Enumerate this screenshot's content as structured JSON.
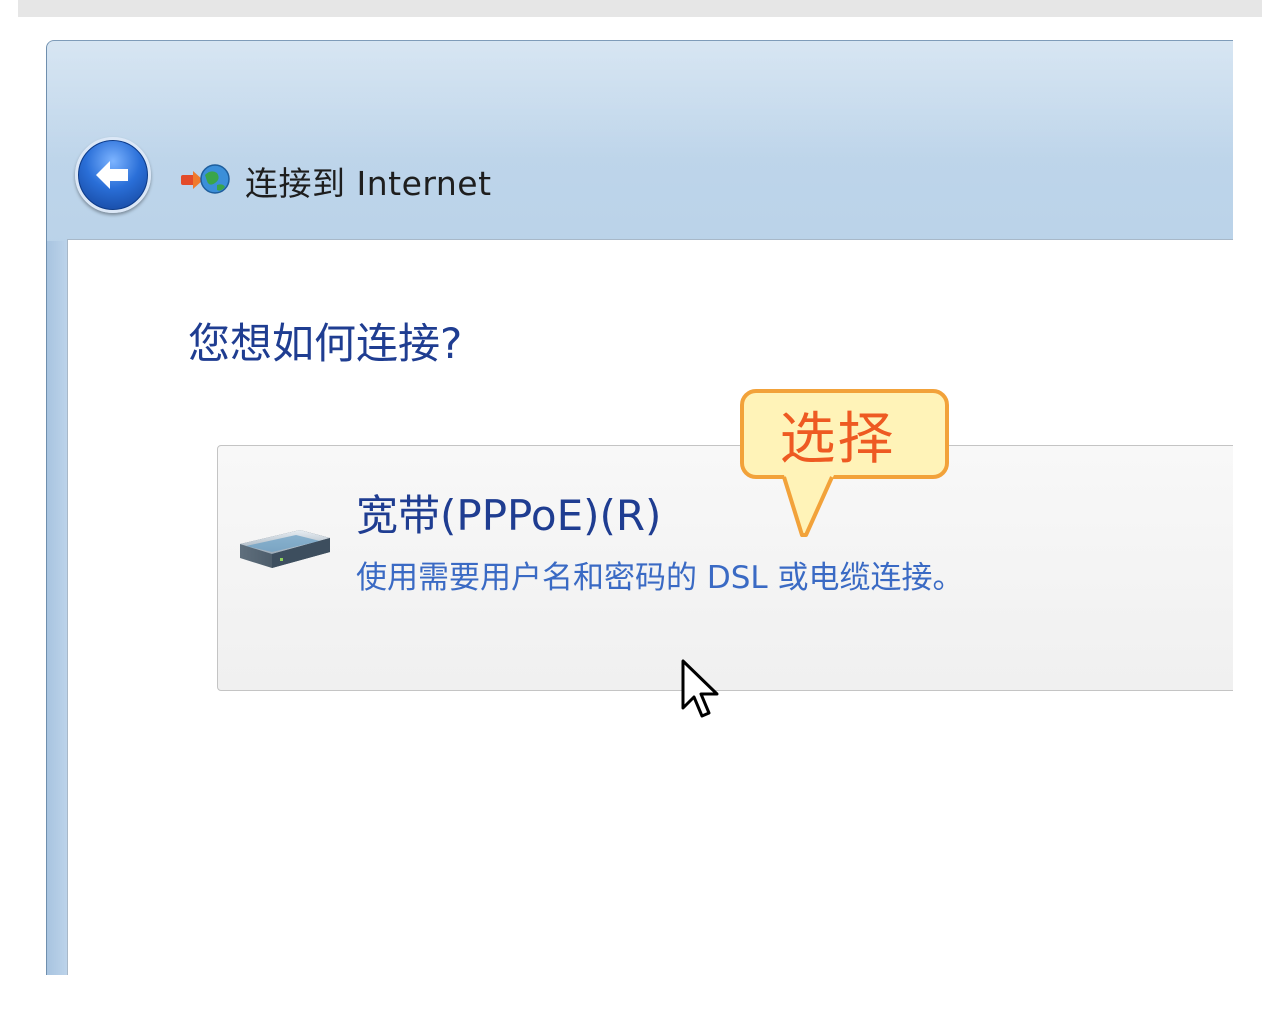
{
  "window": {
    "title": "连接到 Internet",
    "back_button_icon": "back-arrow-icon",
    "title_icon": "network-connection-icon"
  },
  "main": {
    "question": "您想如何连接?",
    "options": [
      {
        "title": "宽带(PPPoE)(R)",
        "description": "使用需要用户名和密码的 DSL 或电缆连接。",
        "icon": "broadband-modem-icon"
      }
    ]
  },
  "annotation": {
    "callout_text": "选择",
    "border_color": "#f2a23a",
    "fill_color": "#fff3b8",
    "text_color": "#ee5a22"
  },
  "colors": {
    "heading": "#1f3d91",
    "description": "#3a6ac4"
  }
}
